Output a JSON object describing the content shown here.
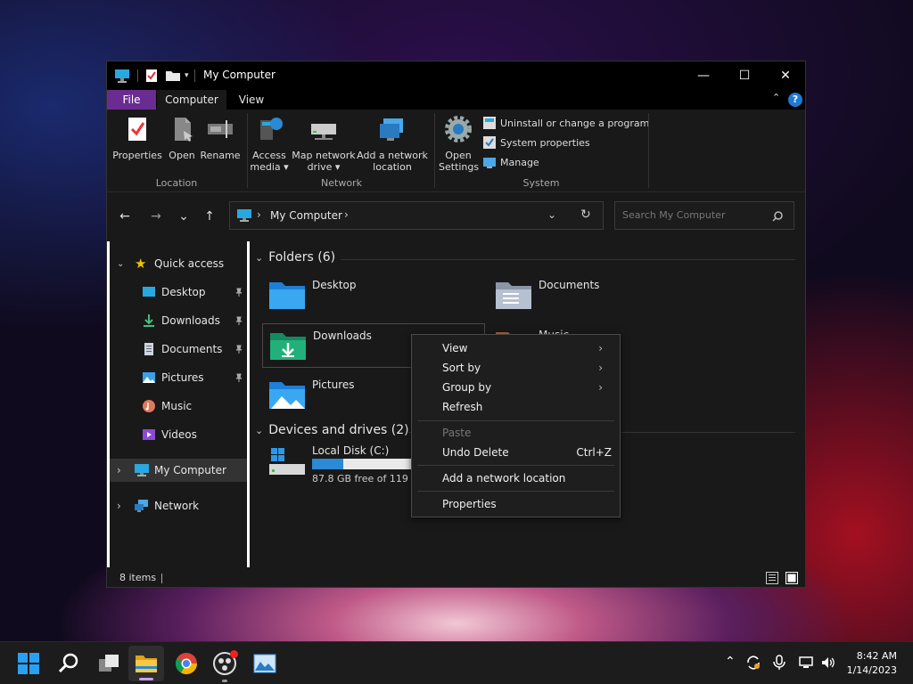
{
  "window": {
    "title": "My Computer",
    "controls": {
      "minimize": "—",
      "maximize": "☐",
      "close": "✕"
    }
  },
  "ribbon_tabs": [
    "File",
    "Computer",
    "View"
  ],
  "ribbon": {
    "location": {
      "label": "Location",
      "buttons": [
        {
          "label": "Properties",
          "icon": "properties-icon"
        },
        {
          "label": "Open",
          "icon": "open-icon"
        },
        {
          "label": "Rename",
          "icon": "rename-icon"
        }
      ]
    },
    "network": {
      "label": "Network",
      "buttons": [
        {
          "label": "Access",
          "label2": "media ▾",
          "icon": "access-media-icon"
        },
        {
          "label": "Map network",
          "label2": "drive ▾",
          "icon": "map-network-drive-icon"
        },
        {
          "label": "Add a network",
          "label2": "location",
          "icon": "add-network-location-icon"
        }
      ]
    },
    "system": {
      "label": "System",
      "open_settings": {
        "label": "Open",
        "label2": "Settings"
      },
      "items": [
        "Uninstall or change a program",
        "System properties",
        "Manage"
      ]
    }
  },
  "nav": {
    "back": "←",
    "forward": "→",
    "recent": "⌄",
    "up": "↑",
    "address": "My Computer",
    "search_placeholder": "Search My Computer"
  },
  "sidebar": {
    "quick_access": "Quick access",
    "items": [
      "Desktop",
      "Downloads",
      "Documents",
      "Pictures",
      "Music",
      "Videos"
    ],
    "my_computer": "My Computer",
    "network": "Network"
  },
  "content": {
    "folders_header": "Folders (6)",
    "folders": [
      "Desktop",
      "Documents",
      "Downloads",
      "Music",
      "Pictures"
    ],
    "drives_header": "Devices and drives (2)",
    "drive": {
      "name": "Local Disk (C:)",
      "free_text": "87.8 GB free of 119 GB",
      "used_fraction": 0.26
    }
  },
  "status": {
    "items": "8 items"
  },
  "context_menu": {
    "items": [
      {
        "label": "View",
        "submenu": "›"
      },
      {
        "label": "Sort by",
        "submenu": "›"
      },
      {
        "label": "Group by",
        "submenu": "›"
      },
      {
        "label": "Refresh"
      },
      {
        "label": "Paste"
      },
      {
        "label": "Undo Delete",
        "shortcut": "Ctrl+Z"
      },
      {
        "label": "Add a network location"
      },
      {
        "label": "Properties"
      }
    ]
  },
  "taskbar": {
    "time": "8:42 AM",
    "date": "1/14/2023"
  },
  "colors": {
    "accent": "#6a2c91",
    "drive_bar": "#2a8ad4",
    "help": "#1f7ad4"
  }
}
